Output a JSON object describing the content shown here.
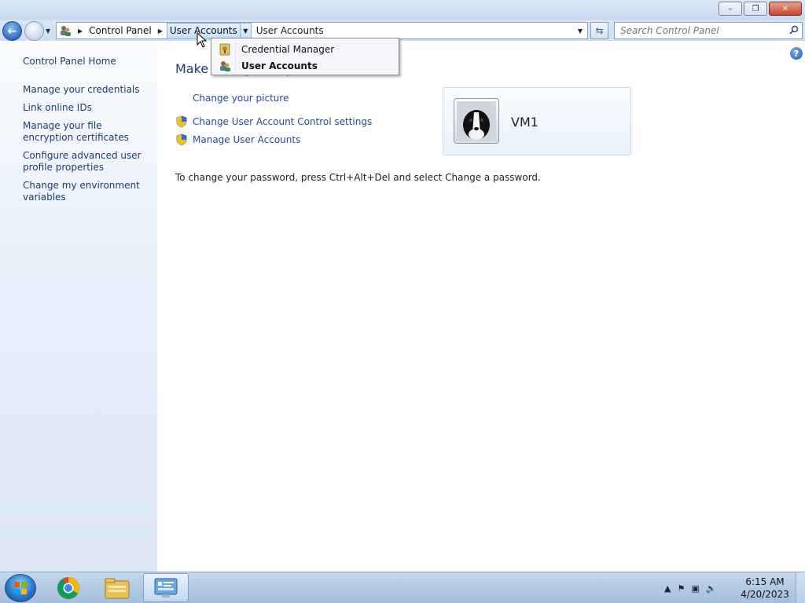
{
  "window": {
    "minimize": "–",
    "maximize": "❐",
    "close": "✕"
  },
  "nav": {
    "breadcrumb": [
      "Control Panel",
      "User Accounts"
    ],
    "address_text": "User Accounts",
    "search_placeholder": "Search Control Panel"
  },
  "crumb_menu": {
    "items": [
      {
        "label": "Credential Manager",
        "icon": "credential-manager-icon"
      },
      {
        "label": "User Accounts",
        "icon": "user-accounts-icon",
        "bold": true
      }
    ]
  },
  "left_pane": {
    "home": "Control Panel Home",
    "links": [
      "Manage your credentials",
      "Link online IDs",
      "Manage your file encryption certificates",
      "Configure advanced user profile properties",
      "Change my environment variables"
    ]
  },
  "main": {
    "heading": "Make changes to your user account",
    "tasks": [
      {
        "label": "Change your picture",
        "shield": false
      },
      {
        "label": "Change User Account Control settings",
        "shield": true
      },
      {
        "label": "Manage User Accounts",
        "shield": true
      }
    ],
    "account_name": "VM1",
    "password_note": "To change your password, press Ctrl+Alt+Del and select Change a password."
  },
  "taskbar": {
    "items": [
      "chrome-icon",
      "file-explorer-icon",
      "control-panel-icon"
    ],
    "time": "6:15 AM",
    "date": "4/20/2023"
  },
  "colors": {
    "link": "#1e4e99",
    "heading": "#1e3c6e",
    "accent": "#2a78c8"
  }
}
